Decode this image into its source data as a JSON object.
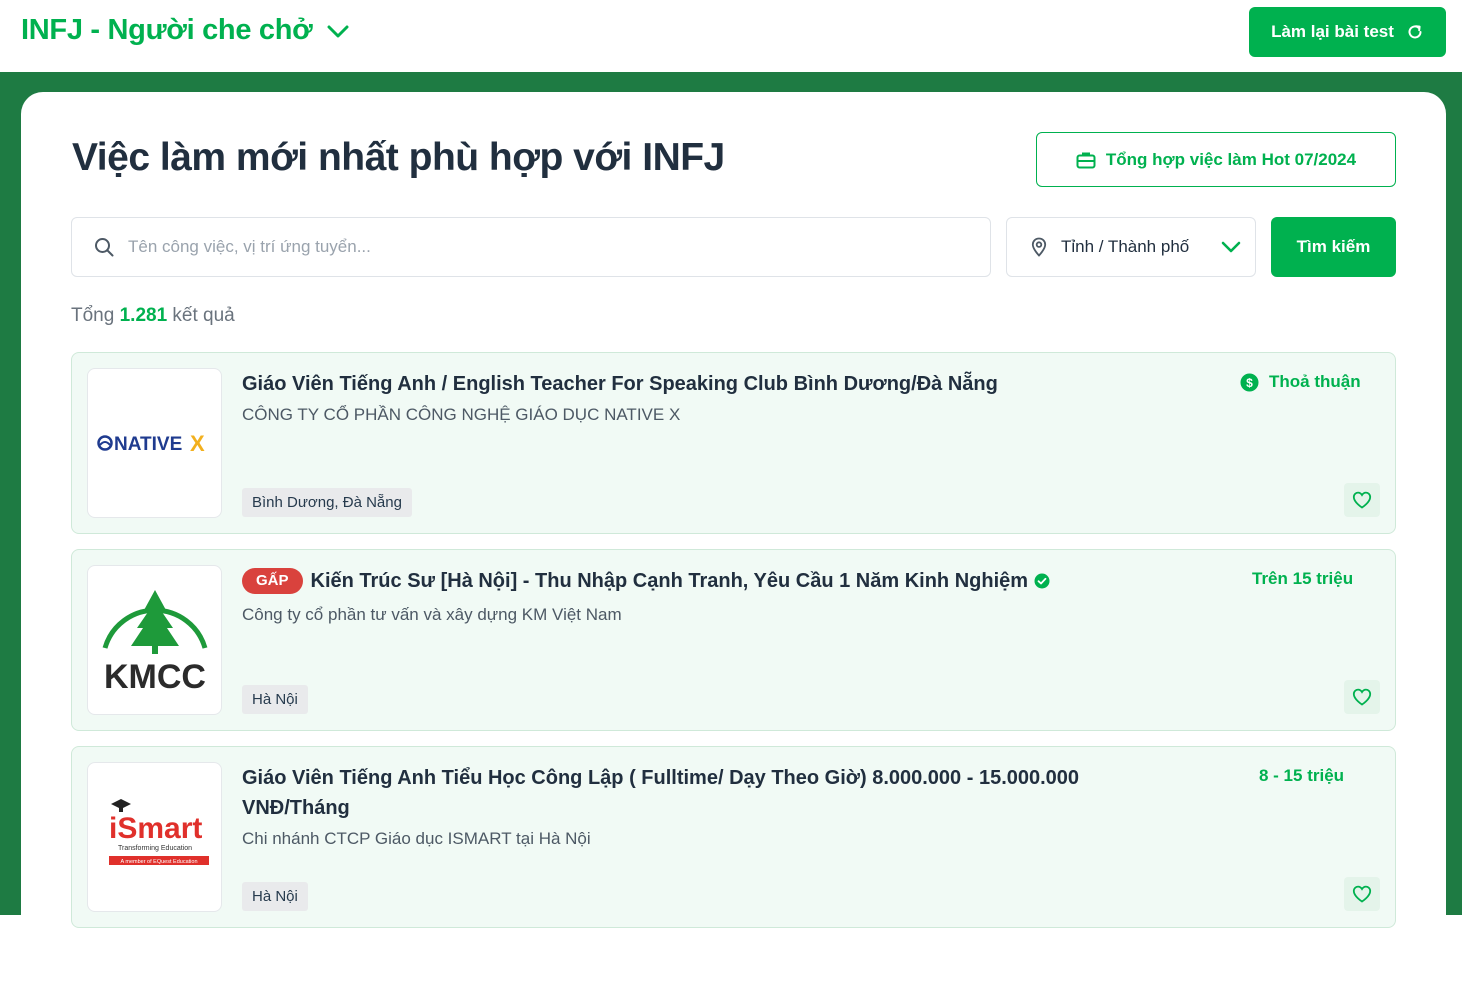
{
  "header": {
    "personality_title": "INFJ - Người che chở",
    "retake_label": "Làm lại bài test"
  },
  "main": {
    "title": "Việc làm mới nhất phù hợp với INFJ",
    "hot_jobs_label": "Tổng hợp việc làm Hot 07/2024",
    "search_placeholder": "Tên công việc, vị trí ứng tuyển...",
    "location_label": "Tỉnh / Thành phố",
    "search_button": "Tìm kiếm",
    "results_prefix": "Tổng",
    "results_count": "1.281",
    "results_suffix": "kết quả"
  },
  "jobs": [
    {
      "title": "Giáo Viên Tiếng Anh / English Teacher For Speaking Club Bình Dương/Đà Nẵng",
      "company": "CÔNG TY CỔ PHẦN CÔNG NGHỆ GIÁO DỤC NATIVE X",
      "salary": "Thoả thuận",
      "location": "Bình Dương, Đà Nẵng",
      "logo_text": "NATIVE",
      "logo_mark": "X"
    },
    {
      "urgent_label": "GẤP",
      "title": "Kiến Trúc Sư [Hà Nội] - Thu Nhập Cạnh Tranh, Yêu Cầu 1 Năm Kinh Nghiệm",
      "company": "Công ty cổ phần tư vấn và xây dựng KM Việt Nam",
      "salary": "Trên 15 triệu",
      "location": "Hà Nội",
      "logo_text": "KMCC"
    },
    {
      "title": "Giáo Viên Tiếng Anh Tiểu Học Công Lập ( Fulltime/ Dạy Theo Giờ) 8.000.000 - 15.000.000 VNĐ/Tháng",
      "company": "Chi nhánh CTCP Giáo dục ISMART tại Hà Nội",
      "salary": "8 - 15 triệu",
      "location": "Hà Nội",
      "logo_text": "iSmart",
      "logo_tagline": "Transforming Education",
      "logo_banner": "A member of EQuest Education"
    }
  ],
  "colors": {
    "brand": "#00b14f",
    "background": "#1e7b43",
    "urgent": "#d9423d"
  }
}
